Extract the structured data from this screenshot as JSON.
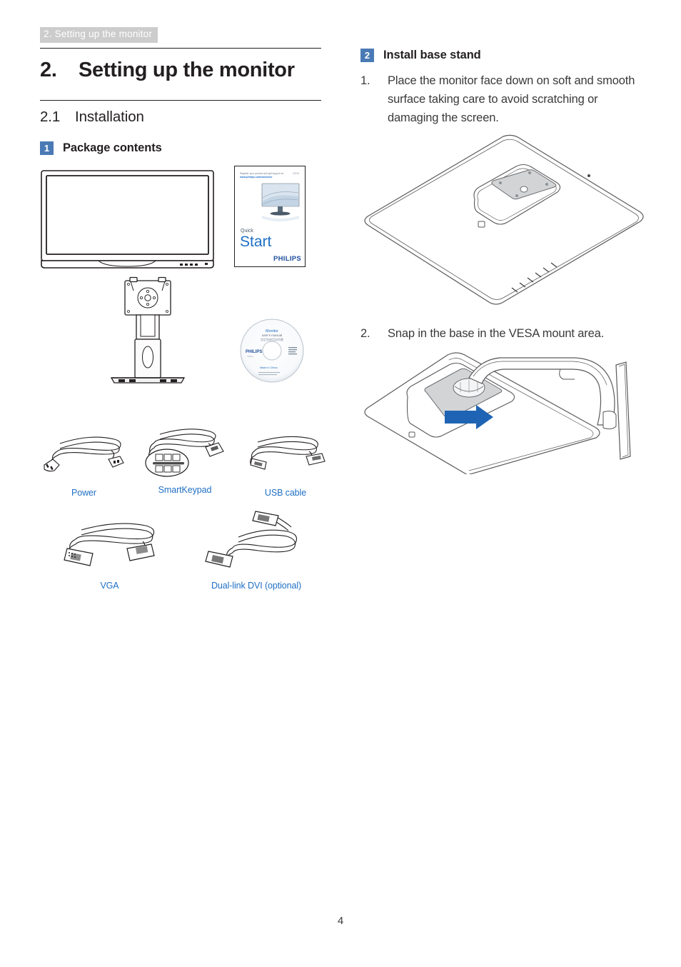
{
  "document": {
    "running_head": "2. Setting up the monitor",
    "page_number": "4"
  },
  "chapter": {
    "number": "2.",
    "title": "Setting up the monitor"
  },
  "section": {
    "number": "2.1",
    "title": "Installation"
  },
  "left_column": {
    "subhead": {
      "badge": "1",
      "label": "Package contents"
    },
    "quick_start_guide": {
      "top_line_1": "Register your product and get support at",
      "top_line_2": "www.philips.com/welcome",
      "corner_code": "220S4",
      "word_quick": "Quick",
      "word_start": "Start",
      "brand": "PHILIPS"
    },
    "disc": {
      "line_1": "Monitor",
      "line_2": "user's manual",
      "line_3": "設定和使用說明書",
      "brand": "PHILIPS",
      "footer": "Made in China"
    },
    "captions": [
      {
        "id": "power",
        "label": "Power"
      },
      {
        "id": "smartkeypad",
        "label": "SmartKeypad"
      },
      {
        "id": "usb-cable",
        "label": "USB cable"
      },
      {
        "id": "vga",
        "label": "VGA"
      },
      {
        "id": "dual-link-dvi",
        "label": "Dual-link DVI (optional)"
      }
    ]
  },
  "right_column": {
    "subhead": {
      "badge": "2",
      "label": "Install base stand"
    },
    "steps": [
      {
        "number": "1.",
        "text": "Place the monitor face down on soft and smooth surface taking care to avoid scratching or damaging the screen."
      },
      {
        "number": "2.",
        "text": "Snap in the base in the VESA mount area."
      }
    ]
  },
  "colors": {
    "badge_blue": "#4a7ab5",
    "caption_blue": "#1f6fc4",
    "running_head_bg": "#cccccc",
    "arrow_blue": "#1f64b4",
    "text": "#231f20"
  }
}
